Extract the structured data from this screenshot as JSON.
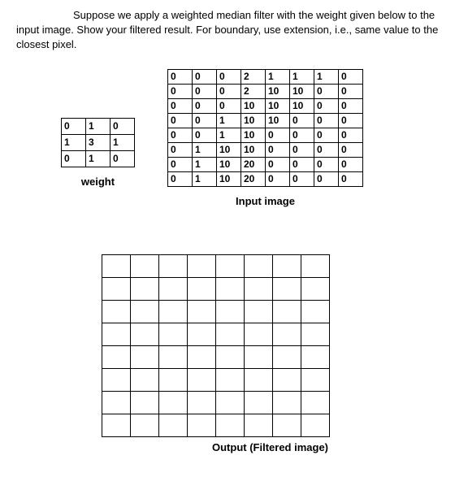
{
  "prompt": "Suppose we apply a weighted median filter with the weight given below to the input image. Show your filtered result. For boundary, use extension, i.e., same value to the closest pixel.",
  "weight": {
    "label": "weight",
    "rows": [
      [
        "0",
        "1",
        "0"
      ],
      [
        "1",
        "3",
        "1"
      ],
      [
        "0",
        "1",
        "0"
      ]
    ]
  },
  "input_image": {
    "label": "Input image",
    "rows": [
      [
        "0",
        "0",
        "0",
        "2",
        "1",
        "1",
        "1",
        "0"
      ],
      [
        "0",
        "0",
        "0",
        "2",
        "10",
        "10",
        "0",
        "0"
      ],
      [
        "0",
        "0",
        "0",
        "10",
        "10",
        "10",
        "0",
        "0"
      ],
      [
        "0",
        "0",
        "1",
        "10",
        "10",
        "0",
        "0",
        "0"
      ],
      [
        "0",
        "0",
        "1",
        "10",
        "0",
        "0",
        "0",
        "0"
      ],
      [
        "0",
        "1",
        "10",
        "10",
        "0",
        "0",
        "0",
        "0"
      ],
      [
        "0",
        "1",
        "10",
        "20",
        "0",
        "0",
        "0",
        "0"
      ],
      [
        "0",
        "1",
        "10",
        "20",
        "0",
        "0",
        "0",
        "0"
      ]
    ]
  },
  "output": {
    "label": "Output (Filtered image)",
    "rows": 8,
    "cols": 8
  }
}
